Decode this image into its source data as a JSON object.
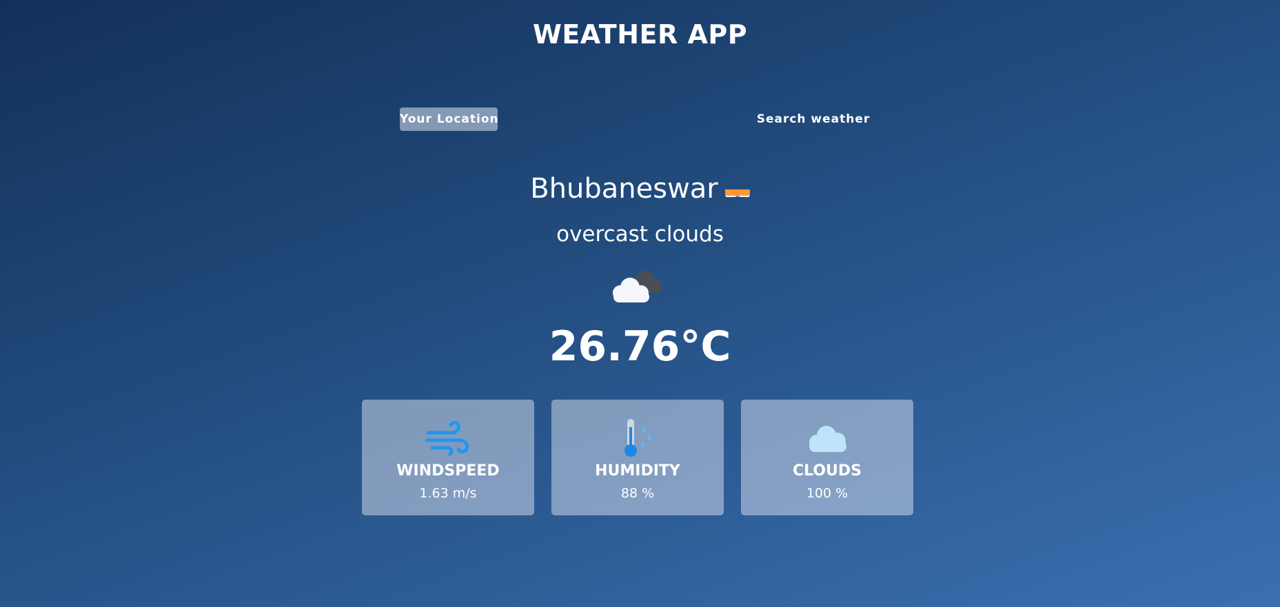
{
  "app": {
    "title": "WEATHER APP"
  },
  "tabs": [
    {
      "label": "Your Location",
      "active": true
    },
    {
      "label": "Search weather",
      "active": false
    }
  ],
  "location": {
    "city": "Bhubaneswar",
    "country_flag_icon": "india-flag-icon"
  },
  "weather": {
    "description": "overcast clouds",
    "icon": "overcast-clouds-icon",
    "temperature": "26.76°C"
  },
  "stats": [
    {
      "label": "WINDSPEED",
      "value": "1.63 m/s",
      "icon": "wind-icon"
    },
    {
      "label": "HUMIDITY",
      "value": "88 %",
      "icon": "humidity-icon"
    },
    {
      "label": "CLOUDS",
      "value": "100 %",
      "icon": "cloud-icon"
    }
  ],
  "colors": {
    "background_top": "#13305a",
    "background_bottom": "#3a70b0",
    "card_background": "#dbe2ef",
    "icon_blue": "#2196f3"
  }
}
